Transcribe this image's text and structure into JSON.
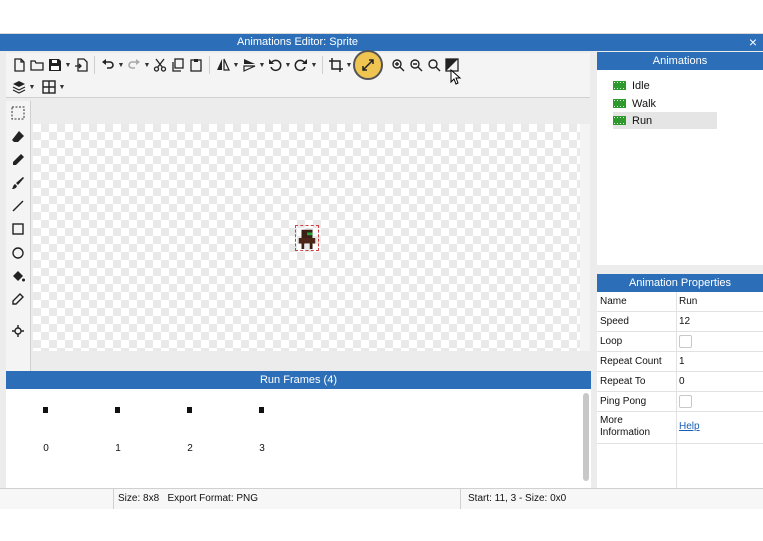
{
  "window": {
    "title": "Animations Editor: Sprite",
    "close_glyph": "×"
  },
  "toolbar": {
    "row1": [
      "new-file-icon",
      "open-folder-icon",
      "save-icon",
      "export-icon",
      "undo-icon",
      "redo-icon",
      "cut-icon",
      "copy-icon",
      "paste-icon",
      "flip-horizontal-icon",
      "flip-vertical-icon",
      "rotate-left-icon",
      "rotate-right-icon",
      "crop-icon",
      "resize-canvas-icon",
      "zoom-in-icon",
      "zoom-out-icon",
      "zoom-fit-icon",
      "invert-icon"
    ],
    "row2": [
      "layers-icon",
      "grid-icon"
    ],
    "highlighted": "resize-canvas-icon"
  },
  "tools": [
    "select-icon",
    "eraser-icon",
    "pencil-icon",
    "brush-icon",
    "line-icon",
    "rectangle-icon",
    "ellipse-icon",
    "fill-bucket-icon",
    "eyedropper-icon",
    "pivot-icon"
  ],
  "frames_panel": {
    "header": "Run Frames (4)",
    "frames": [
      {
        "label": "0"
      },
      {
        "label": "1"
      },
      {
        "label": "2"
      },
      {
        "label": "3"
      }
    ]
  },
  "status": {
    "size": "Size: 8x8",
    "format": "Export Format: PNG",
    "selection": "Start: 11, 3 - Size: 0x0"
  },
  "animations_panel": {
    "header": "Animations",
    "items": [
      {
        "label": "Idle"
      },
      {
        "label": "Walk"
      },
      {
        "label": "Run"
      }
    ],
    "selected": "Run"
  },
  "properties_panel": {
    "header": "Animation Properties",
    "rows": [
      {
        "name": "Name",
        "value": "Run"
      },
      {
        "name": "Speed",
        "value": "12"
      },
      {
        "name": "Loop",
        "checked": false
      },
      {
        "name": "Repeat Count",
        "value": "1"
      },
      {
        "name": "Repeat To",
        "value": "0"
      },
      {
        "name": "Ping Pong",
        "checked": false
      },
      {
        "name": "More\nInformation",
        "link": "Help"
      }
    ]
  },
  "colors": {
    "accent": "#2c6fb8",
    "highlight": "#f0c450",
    "film_icon": "#2e9a2e",
    "link": "#1a5fb4"
  }
}
